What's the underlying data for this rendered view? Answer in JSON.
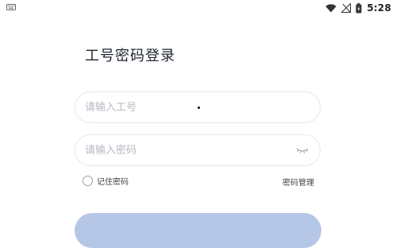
{
  "status_bar": {
    "time": "5:28",
    "icons": [
      "keyboard-icon",
      "wifi-icon",
      "signal-icon",
      "battery-icon"
    ]
  },
  "login": {
    "title": "工号密码登录",
    "employee_id": {
      "placeholder": "请输入工号",
      "value": ""
    },
    "password": {
      "placeholder": "请输入密码",
      "value": ""
    },
    "remember_label": "记住密码",
    "remember_checked": false,
    "manage_password_label": "密码管理",
    "login_button_label": ""
  },
  "colors": {
    "title": "#1f2430",
    "placeholder": "#b5b9c1",
    "field_border": "#e6e8ee",
    "button_bg": "#b6c6e6"
  }
}
